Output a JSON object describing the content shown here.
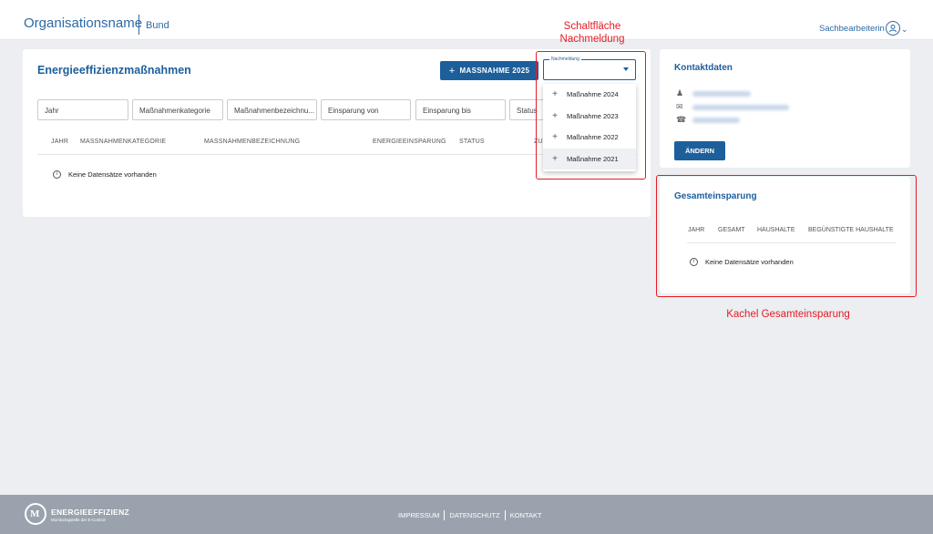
{
  "header": {
    "org_name": "Organisationsname",
    "org_level": "Bund",
    "user_label": "Sachbearbeiterin"
  },
  "main": {
    "title": "Energieeffizienzmaßnahmen",
    "add_button": "MASSNAHME 2025",
    "nachmeldung_label": "Nachmeldung",
    "filters": [
      "Jahr",
      "Maßnahmenkategorie",
      "Maßnahmenbezeichnu...",
      "Einsparung von",
      "Einsparung bis",
      "Status"
    ],
    "columns": [
      "JAHR",
      "MASSNAHMENKATEGORIE",
      "MASSNAHMENBEZEICHNUNG",
      "ENERGIEEINSPARUNG",
      "STATUS",
      "ZU"
    ],
    "empty_text": "Keine Datensätze vorhanden"
  },
  "dropdown": {
    "items": [
      "Maßnahme 2024",
      "Maßnahme 2023",
      "Maßnahme 2022",
      "Maßnahme 2021"
    ]
  },
  "contact": {
    "title": "Kontaktdaten",
    "change_button": "ÄNDERN"
  },
  "total": {
    "title": "Gesamteinsparung",
    "columns": [
      "JAHR",
      "GESAMT",
      "HAUSHALTE",
      "BEGÜNSTIGTE HAUSHALTE"
    ],
    "empty_text": "Keine Datensätze vorhanden"
  },
  "annotations": {
    "nachmeldung_line1": "Schaltfläche",
    "nachmeldung_line2": "Nachmeldung",
    "total_label": "Kachel Gesamteinsparung",
    "color": "#e51b24"
  },
  "footer": {
    "logo_text": "ENERGIEEFFIZIENZ",
    "logo_sub": "Monitoringstelle der E-Control",
    "links": [
      "IMPRESSUM",
      "DATENSCHUTZ",
      "KONTAKT"
    ]
  },
  "colors": {
    "brand": "#1d5f9b",
    "background": "#eceef1",
    "footer": "#9aa3ad"
  }
}
